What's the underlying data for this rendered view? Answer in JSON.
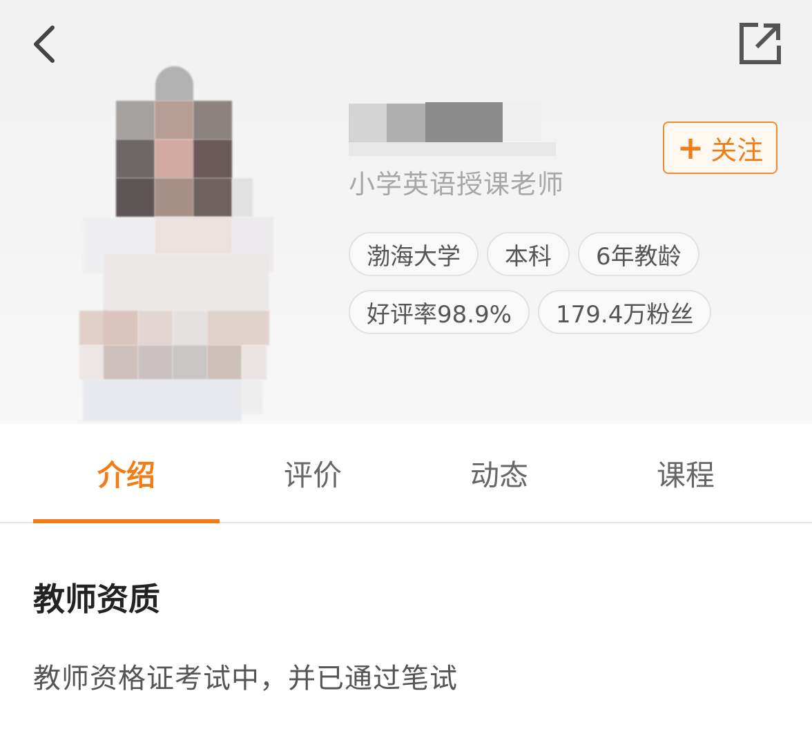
{
  "header": {
    "subtitle": "小学英语授课老师",
    "follow_label": "关注",
    "tags_row1": [
      "渤海大学",
      "本科",
      "6年教龄"
    ],
    "tags_row2": [
      "好评率98.9%",
      "179.4万粉丝"
    ]
  },
  "tabs": [
    {
      "label": "介绍",
      "active": true
    },
    {
      "label": "评价",
      "active": false
    },
    {
      "label": "动态",
      "active": false
    },
    {
      "label": "课程",
      "active": false
    }
  ],
  "section": {
    "title": "教师资质",
    "text": "教师资格证考试中，并已通过笔试"
  },
  "colors": {
    "accent": "#f07d18",
    "header_bg": "#f3f3f3",
    "tag_border": "#e2e2e2"
  },
  "icons": [
    "back-chevron-icon",
    "share-icon",
    "plus-icon"
  ]
}
